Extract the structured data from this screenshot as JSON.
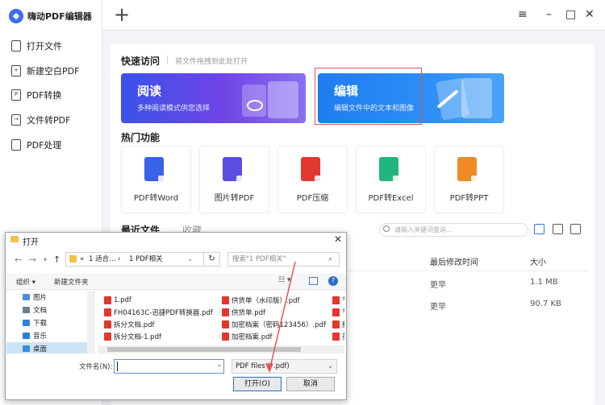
{
  "app": {
    "title": "嗨动PDF编辑器"
  },
  "sidebar": {
    "items": [
      {
        "label": "打开文件"
      },
      {
        "label": "新建空白PDF"
      },
      {
        "label": "PDF转换"
      },
      {
        "label": "文件转PDF"
      },
      {
        "label": "PDF处理"
      }
    ]
  },
  "quick_access": {
    "title": "快速访问",
    "hint": "将文件拖拽到此处打开",
    "cards": [
      {
        "title": "阅读",
        "subtitle": "多种阅读模式供您选择"
      },
      {
        "title": "编辑",
        "subtitle": "编辑文件中的文本和图像"
      }
    ]
  },
  "hot": {
    "title": "热门功能",
    "items": [
      {
        "label": "PDF转Word",
        "color": "#3a62e8"
      },
      {
        "label": "图片转PDF",
        "color": "#5b4ee0"
      },
      {
        "label": "PDF压缩",
        "color": "#e0382f"
      },
      {
        "label": "PDF转Excel",
        "color": "#22b57c"
      },
      {
        "label": "PDF转PPT",
        "color": "#f08a24"
      }
    ]
  },
  "recent": {
    "tabs": [
      "最近文件",
      "收藏"
    ],
    "search_placeholder": "请输入关键词查询...",
    "columns": [
      "最后修改时间",
      "大小"
    ],
    "rows": [
      {
        "modified": "更早",
        "size": "1.1 MB"
      },
      {
        "modified": "更早",
        "size": "90.7 KB"
      }
    ]
  },
  "dialog": {
    "title": "打开",
    "address": [
      "«",
      "1 适合…",
      "›",
      "1 PDF相关"
    ],
    "search_placeholder": "搜索\"1 PDF相关\"",
    "organize": "组织",
    "new_folder": "新建文件夹",
    "tree": [
      {
        "label": "图片",
        "color": "#4a8fd8"
      },
      {
        "label": "文档",
        "color": "#6d7f93"
      },
      {
        "label": "下载",
        "color": "#2f7fd6"
      },
      {
        "label": "音乐",
        "color": "#2f7fd6"
      },
      {
        "label": "桌面",
        "color": "#3a8bd8"
      }
    ],
    "files_col1": [
      "1.pdf",
      "FH04163C-迅捷PDF转换器.pdf",
      "拆分文档.pdf",
      "拆分文档-1.pdf"
    ],
    "files_col2": [
      "供货单（水印版）.pdf",
      "供货单.pdf",
      "加密档案（密码123456）.pdf",
      "加密档案.pdf"
    ],
    "files_col3": [
      "节",
      "节",
      "删",
      "英"
    ],
    "filename_label": "文件名(N):",
    "filetype": "PDF files (*.pdf)",
    "open_button": "打开(O)",
    "cancel_button": "取消"
  }
}
